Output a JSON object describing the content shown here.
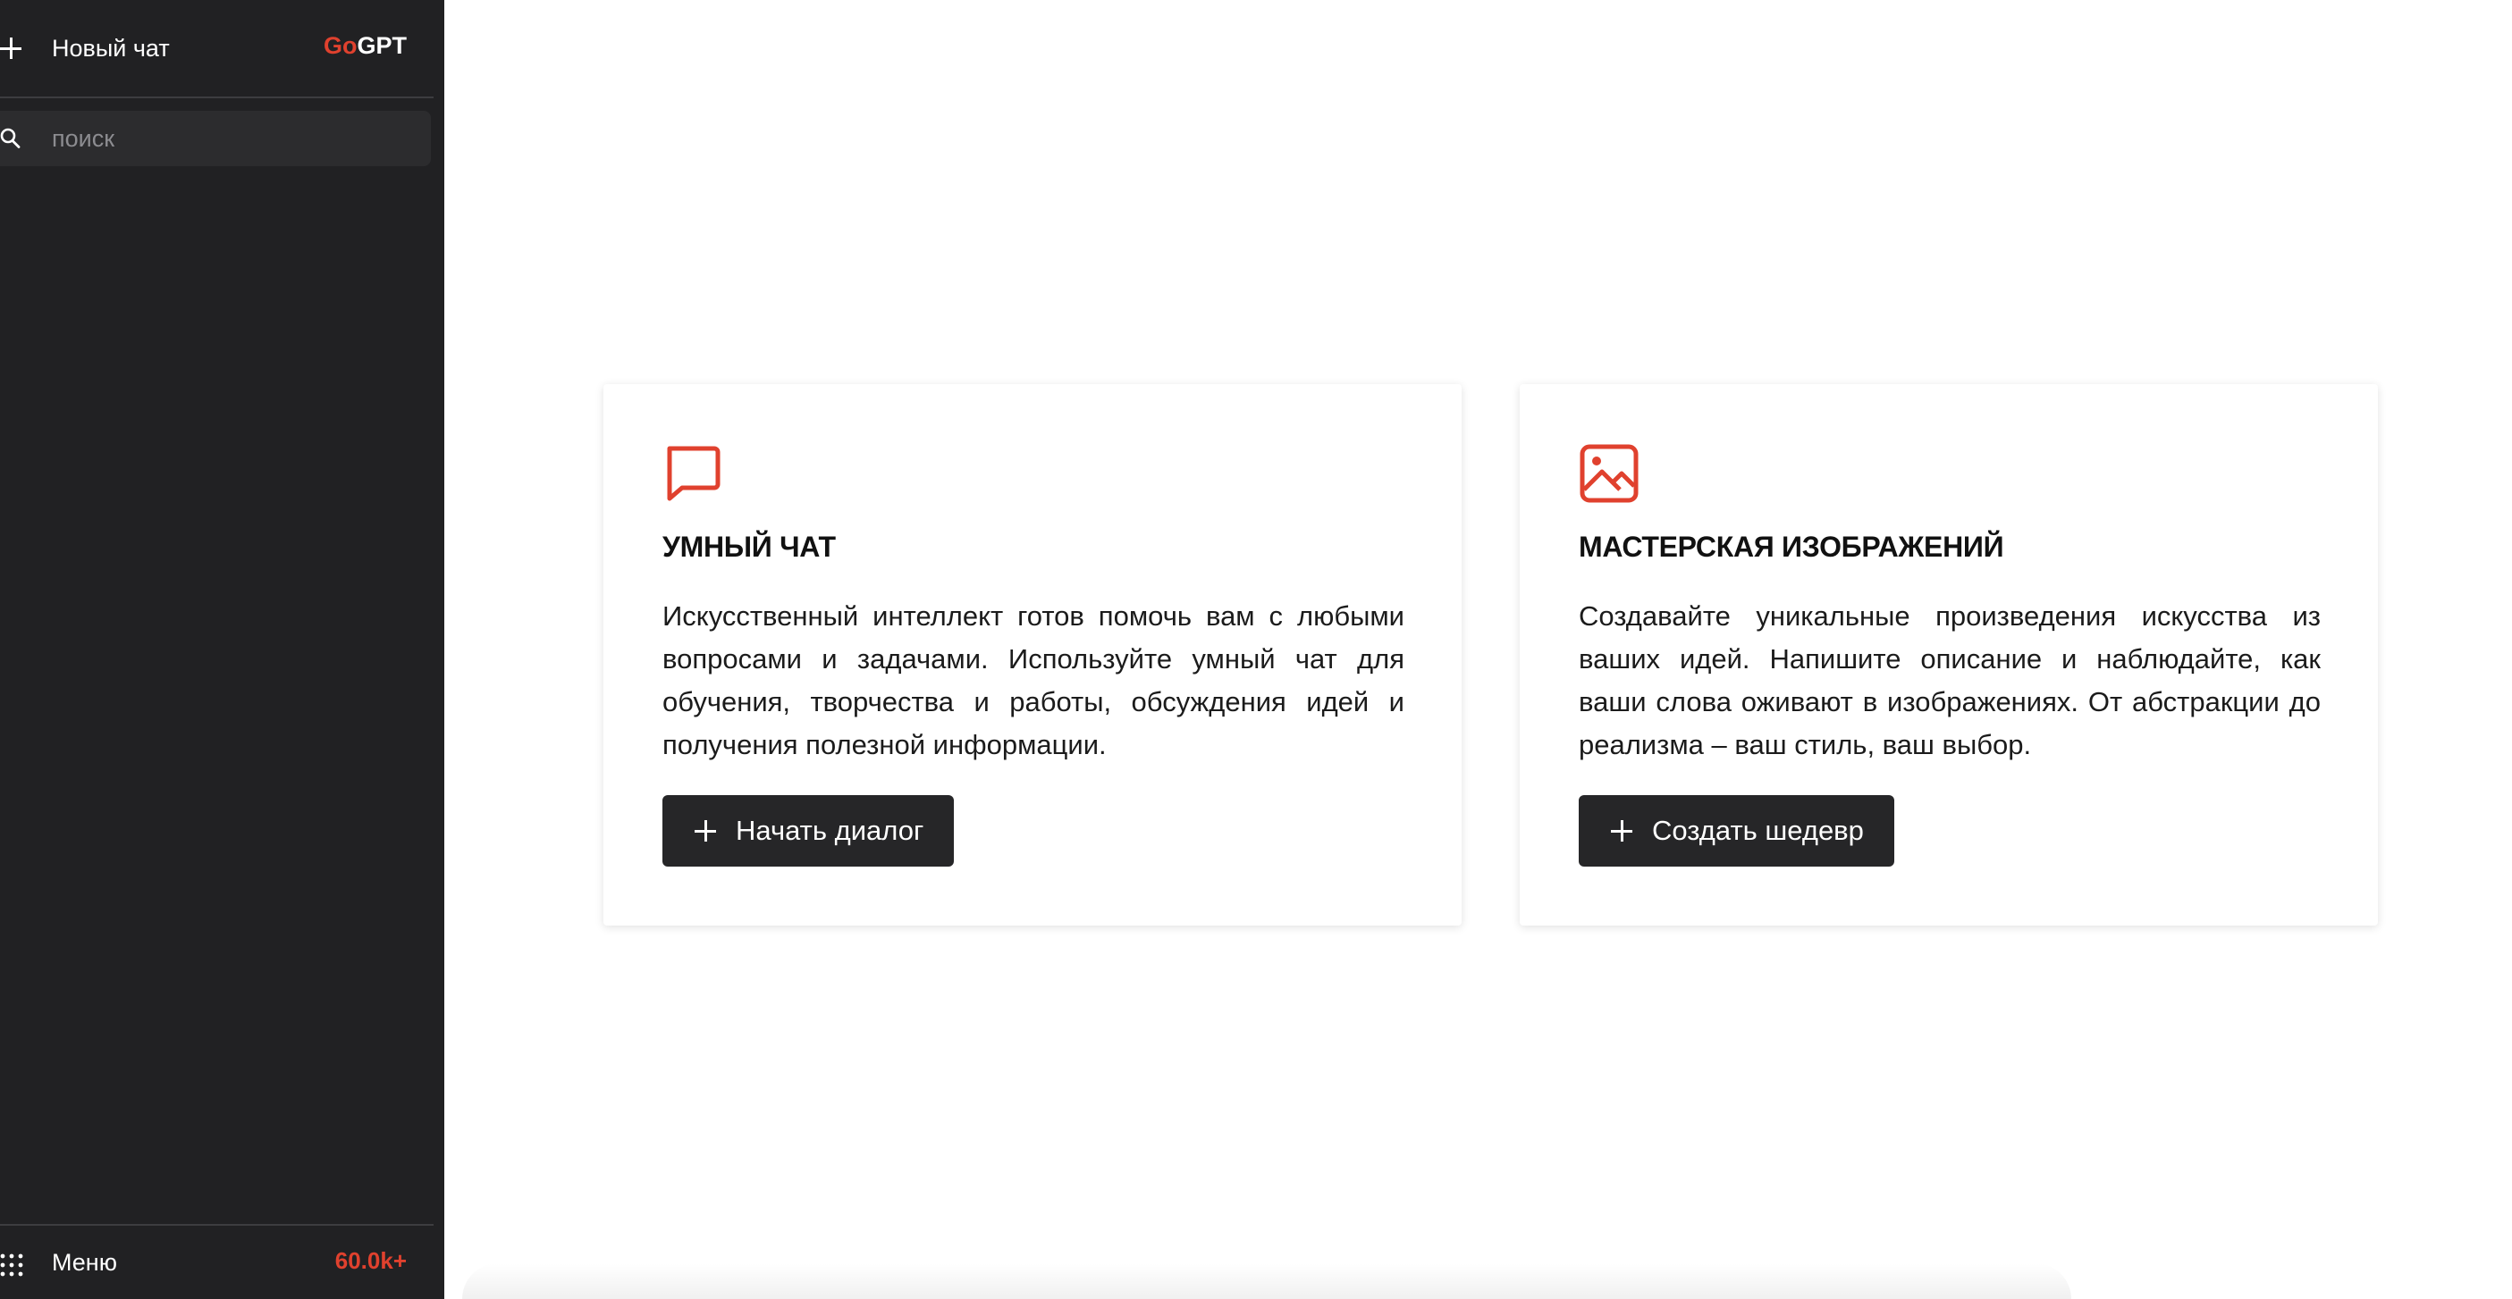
{
  "sidebar": {
    "new_chat_label": "Новый чат",
    "logo_part1": "Go",
    "logo_part2": "GPT",
    "search_placeholder": "поиск",
    "menu_label": "Меню",
    "count_badge": "60.0k+"
  },
  "cards": [
    {
      "icon": "chat-bubble-icon",
      "title": "УМНЫЙ ЧАТ",
      "text": "Искусственный интеллект готов помочь вам с любыми вопросами и задачами. Используйте умный чат для обучения, творчества и работы, обсуждения идей и получения полезной информации.",
      "button_label": "Начать диалог"
    },
    {
      "icon": "image-icon",
      "title": "МАСТЕРСКАЯ ИЗОБРАЖЕНИЙ",
      "text": "Создавайте уникальные произведения искусства из ваших идей. Напишите описание и наблюдайте, как ваши слова оживают в изображениях. От абстракции до реализма – ваш стиль, ваш выбор.",
      "button_label": "Создать шедевр"
    }
  ],
  "colors": {
    "accent": "#e0412e",
    "sidebar_bg": "#212123",
    "button_bg": "#262628"
  }
}
